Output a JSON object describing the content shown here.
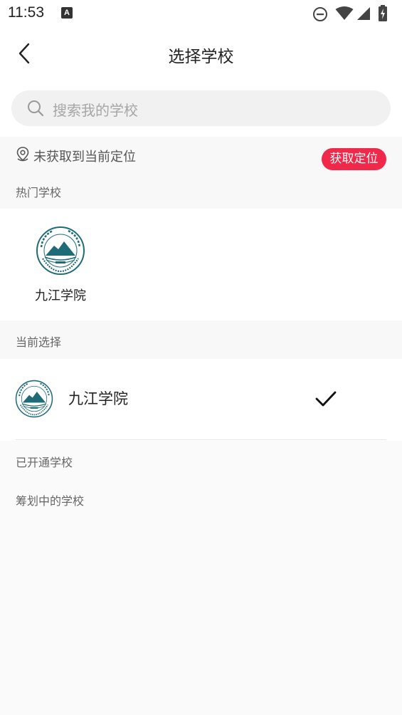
{
  "status_bar": {
    "time": "11:53",
    "notification_letter": "A",
    "icons": [
      "dnd-icon",
      "wifi-icon",
      "signal-icon",
      "battery-charging-icon"
    ]
  },
  "nav": {
    "title": "选择学校",
    "back_icon": "chevron-left-icon"
  },
  "search": {
    "placeholder": "搜索我的学校",
    "icon": "search-icon"
  },
  "location": {
    "status_text": "未获取到当前定位",
    "button_label": "获取定位",
    "button_color": "#f0284a"
  },
  "hot_schools": {
    "label": "热门学校",
    "items": [
      {
        "name": "九江学院",
        "logo_icon": "jiujiang-university-logo"
      }
    ]
  },
  "current": {
    "label": "当前选择",
    "school_name": "九江学院",
    "selected": true
  },
  "sections": {
    "opened_label": "已开通学校",
    "planning_label": "筹划中的学校"
  }
}
